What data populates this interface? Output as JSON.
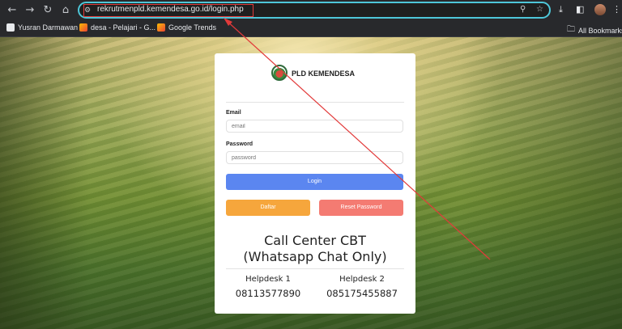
{
  "browser": {
    "url": "rekrutmenpld.kemendesa.go.id/login.php",
    "nav": {
      "back": "←",
      "forward": "→",
      "reload": "↻",
      "home": "⌂"
    },
    "bookmarks": [
      {
        "label": "Yusran Darmawan",
        "icon": "gh-icon"
      },
      {
        "label": "desa - Pelajari - G...",
        "icon": "trends-icon"
      },
      {
        "label": "Google Trends",
        "icon": "trends-icon"
      }
    ],
    "all_bookmarks": "All Bookmarks"
  },
  "login": {
    "brand": "PLD KEMENDESA",
    "email_label": "Email",
    "email_placeholder": "email",
    "password_label": "Password",
    "password_placeholder": "password",
    "login_button": "Login",
    "daftar_button": "Daftar",
    "reset_button": "Reset Password"
  },
  "callcenter": {
    "title_line1": "Call Center CBT",
    "title_line2": "(Whatsapp Chat Only)",
    "helpdesks": [
      {
        "label": "Helpdesk 1",
        "number": "08113577890"
      },
      {
        "label": "Helpdesk 2",
        "number": "085175455887"
      }
    ]
  },
  "colors": {
    "login": "#5b86f0",
    "daftar": "#f6a63c",
    "reset": "#f47b72",
    "annotation": "#e23a3a"
  }
}
